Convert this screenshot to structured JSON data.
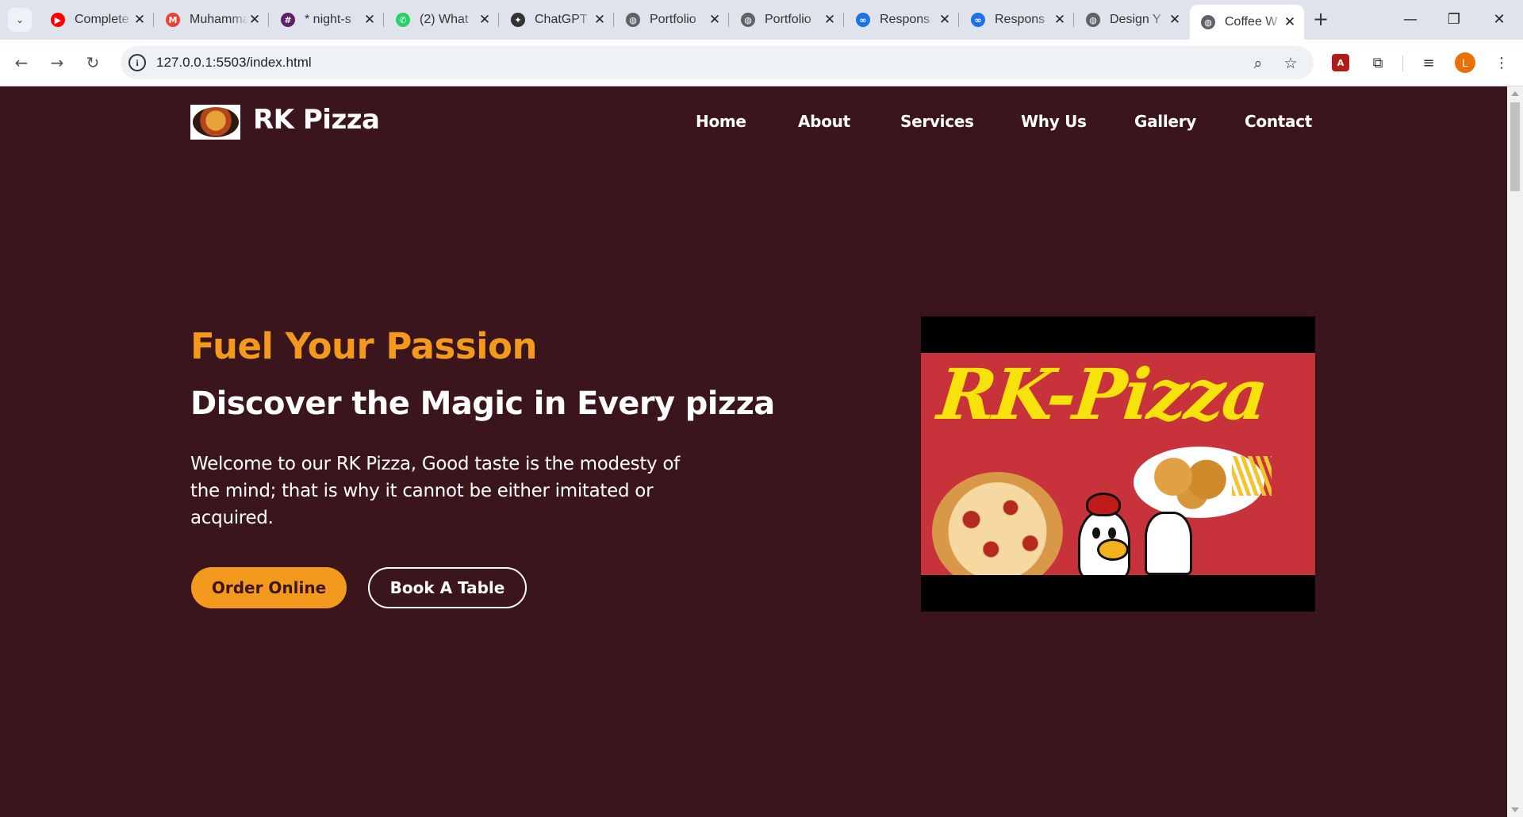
{
  "browser": {
    "tabs": [
      {
        "title": "Complete",
        "favicon": "youtube-icon",
        "color": "#ff0000",
        "glyph": "▶",
        "active": false
      },
      {
        "title": "Muhammad",
        "favicon": "gmail-icon",
        "color": "#ea4335",
        "glyph": "M",
        "active": false
      },
      {
        "title": "* night-s",
        "favicon": "slack-icon",
        "color": "#611f69",
        "glyph": "#",
        "active": false
      },
      {
        "title": "(2) What",
        "favicon": "whatsapp-icon",
        "color": "#25d366",
        "glyph": "✆",
        "active": false
      },
      {
        "title": "ChatGPT",
        "favicon": "chatgpt-icon",
        "color": "#333333",
        "glyph": "✦",
        "active": false
      },
      {
        "title": "Portfolio",
        "favicon": "globe-icon",
        "color": "#5f6368",
        "glyph": "◍",
        "active": false
      },
      {
        "title": "Portfolio",
        "favicon": "globe-icon",
        "color": "#5f6368",
        "glyph": "◍",
        "active": false
      },
      {
        "title": "Respons",
        "favicon": "responsive-icon",
        "color": "#1a73e8",
        "glyph": "∞",
        "active": false
      },
      {
        "title": "Respons",
        "favicon": "responsive-icon",
        "color": "#1a73e8",
        "glyph": "∞",
        "active": false
      },
      {
        "title": "Design Y",
        "favicon": "globe-icon",
        "color": "#5f6368",
        "glyph": "◍",
        "active": false
      },
      {
        "title": "Coffee W",
        "favicon": "globe-icon",
        "color": "#5f6368",
        "glyph": "◍",
        "active": true
      }
    ],
    "url": "127.0.0.1:5503/index.html",
    "profile_initial": "L"
  },
  "site": {
    "brand": "RK Pizza",
    "nav": [
      "Home",
      "About",
      "Services",
      "Why Us",
      "Gallery",
      "Contact"
    ],
    "hero": {
      "kicker": "Fuel Your Passion",
      "title": "Discover the Magic in Every pizza",
      "text": "Welcome to our RK Pizza, Good taste is the modesty of the mind; that is why it cannot be either imitated or acquired.",
      "order_label": "Order Online",
      "book_label": "Book A Table",
      "banner_text": "RK-Pizza"
    }
  },
  "colors": {
    "page_bg": "#3b151c",
    "accent": "#f39a1e",
    "banner_bg": "#c8323a",
    "banner_text": "#f7e20b"
  }
}
